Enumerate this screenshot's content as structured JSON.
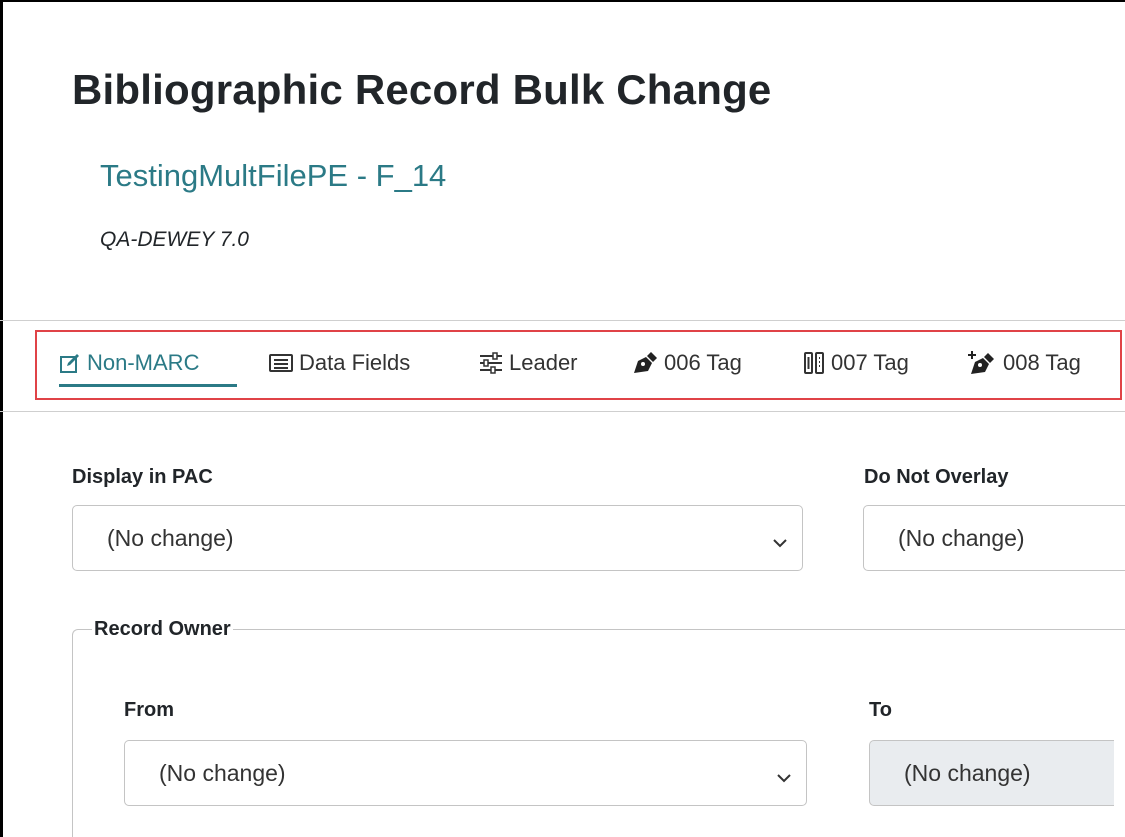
{
  "header": {
    "title": "Bibliographic Record Bulk Change",
    "record_set": "TestingMultFilePE - F_14",
    "database": "QA-DEWEY 7.0"
  },
  "tabs": [
    {
      "label": "Non-MARC",
      "icon": "edit-square-icon",
      "active": true
    },
    {
      "label": "Data Fields",
      "icon": "list-card-icon",
      "active": false
    },
    {
      "label": "Leader",
      "icon": "sliders-icon",
      "active": false
    },
    {
      "label": "006 Tag",
      "icon": "pen-nib-icon",
      "active": false
    },
    {
      "label": "007 Tag",
      "icon": "columns-icon",
      "active": false
    },
    {
      "label": "008 Tag",
      "icon": "pen-nib-plus-icon",
      "active": false
    }
  ],
  "form": {
    "display_in_pac": {
      "label": "Display in PAC",
      "value": "(No change)"
    },
    "do_not_overlay": {
      "label": "Do Not Overlay",
      "value": "(No change)"
    },
    "record_owner": {
      "legend": "Record Owner",
      "from": {
        "label": "From",
        "value": "(No change)"
      },
      "to": {
        "label": "To",
        "value": "(No change)",
        "disabled": true
      }
    }
  },
  "colors": {
    "accent": "#2b7a86",
    "highlight_border": "#e04347",
    "disabled_bg": "#e9ecef"
  }
}
